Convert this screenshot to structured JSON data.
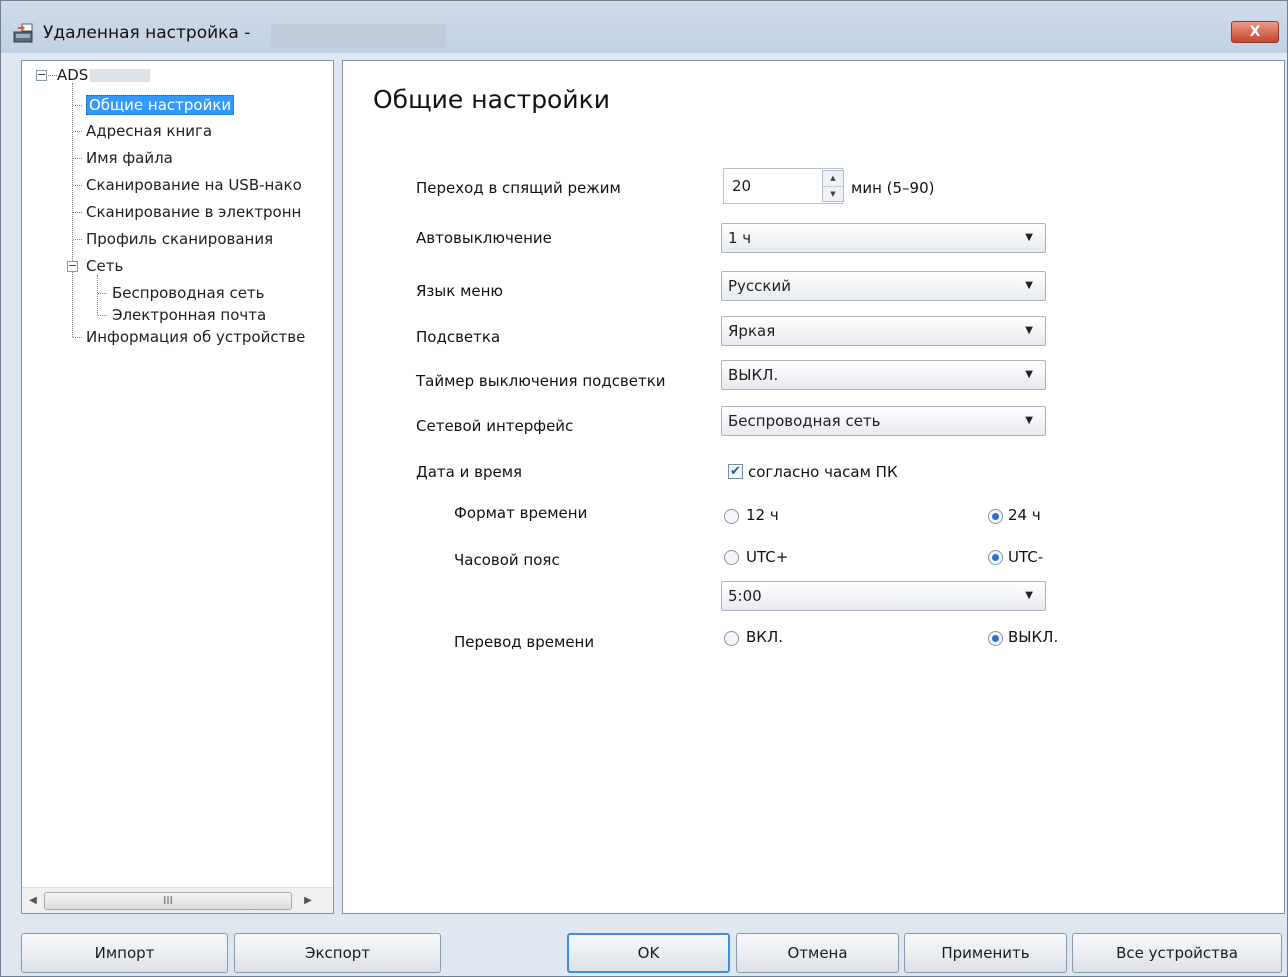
{
  "window": {
    "title": "Удаленная настройка -",
    "close_label": "X"
  },
  "tree": {
    "root": "ADS",
    "items": [
      "Общие настройки",
      "Адресная книга",
      "Имя файла",
      "Сканирование на USB-нако",
      "Сканирование в электронн",
      "Профиль сканирования",
      "Сеть",
      "Беспроводная сеть",
      "Электронная почта",
      "Информация об устройстве"
    ],
    "scroll_thumb_label": "III"
  },
  "panel": {
    "heading": "Общие настройки",
    "sleep": {
      "label": "Переход в спящий режим",
      "value": "20",
      "unit": "мин (5–90)"
    },
    "auto_off": {
      "label": "Автовыключение",
      "value": "1 ч"
    },
    "language": {
      "label": "Язык меню",
      "value": "Русский"
    },
    "backlight": {
      "label": "Подсветка",
      "value": "Яркая"
    },
    "backlight_timer": {
      "label": "Таймер выключения подсветки",
      "value": "ВЫКЛ."
    },
    "net_if": {
      "label": "Сетевой интерфейс",
      "value": "Беспроводная сеть"
    },
    "datetime": {
      "label": "Дата и время",
      "sync_label": "согласно часам ПК",
      "sync_checked": true
    },
    "time_format": {
      "label": "Формат времени",
      "opt1": "12 ч",
      "opt2": "24 ч",
      "selected": "24 ч"
    },
    "timezone": {
      "label": "Часовой пояс",
      "opt1": "UTC+",
      "opt2": "UTC-",
      "selected": "UTC-",
      "offset": "5:00"
    },
    "dst": {
      "label": "Перевод времени",
      "opt1": "ВКЛ.",
      "opt2": "ВЫКЛ.",
      "selected": "ВЫКЛ."
    }
  },
  "buttons": {
    "import": "Импорт",
    "export": "Экспорт",
    "ok": "OK",
    "cancel": "Отмена",
    "apply": "Применить",
    "all_devices": "Все устройства"
  }
}
